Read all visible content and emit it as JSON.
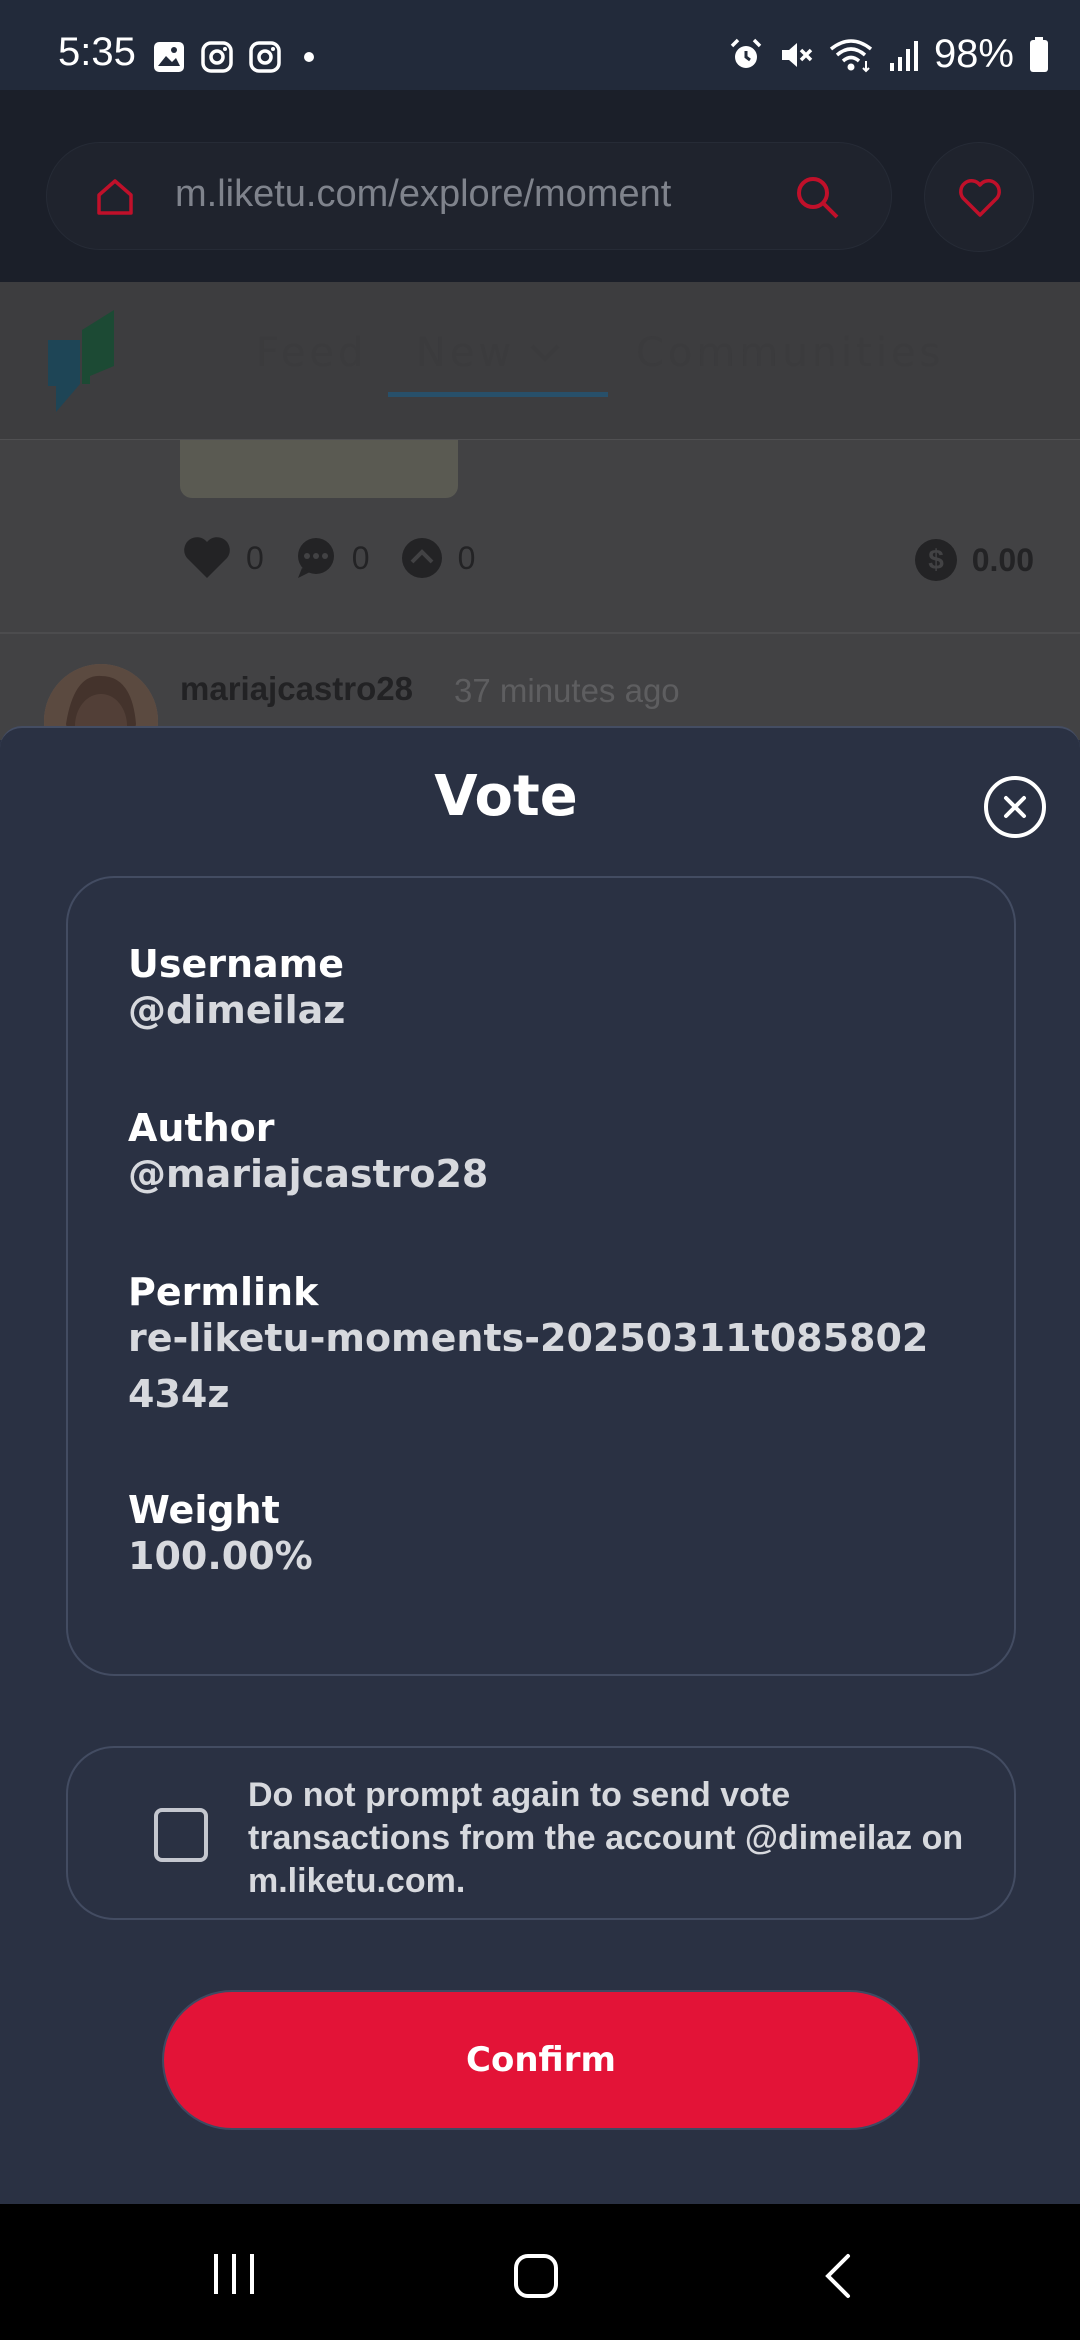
{
  "status_bar": {
    "time": "5:35",
    "battery": "98%",
    "icons": [
      "gallery-icon",
      "instagram-icon",
      "instagram-icon",
      "dot-icon",
      "alarm-icon",
      "mute-icon",
      "wifi-icon",
      "signal-icon",
      "battery-icon"
    ]
  },
  "browser": {
    "url": "m.liketu.com/explore/moment",
    "accent": "#e31337"
  },
  "site_nav": {
    "tabs": [
      {
        "label": "Feed"
      },
      {
        "label": "New"
      },
      {
        "label": "Communities"
      }
    ],
    "active_tab": "New"
  },
  "feed": {
    "stats": {
      "likes": "0",
      "comments": "0",
      "votes": "0"
    },
    "payout": "0.00",
    "next_post": {
      "author": "mariajcastro28",
      "time_ago": "37 minutes ago"
    }
  },
  "modal": {
    "title": "Vote",
    "fields": [
      {
        "label": "Username",
        "value": "@dimeilaz"
      },
      {
        "label": "Author",
        "value": "@mariajcastro28"
      },
      {
        "label": "Permlink",
        "value": "re-liketu-moments-20250311t085802434z"
      },
      {
        "label": "Weight",
        "value": "100.00%"
      }
    ],
    "prompt_text": "Do not prompt again to send vote transactions from the account @dimeilaz on m.liketu.com.",
    "confirm_label": "Confirm",
    "confirm_color": "#e31337",
    "background": "#2a3143"
  }
}
